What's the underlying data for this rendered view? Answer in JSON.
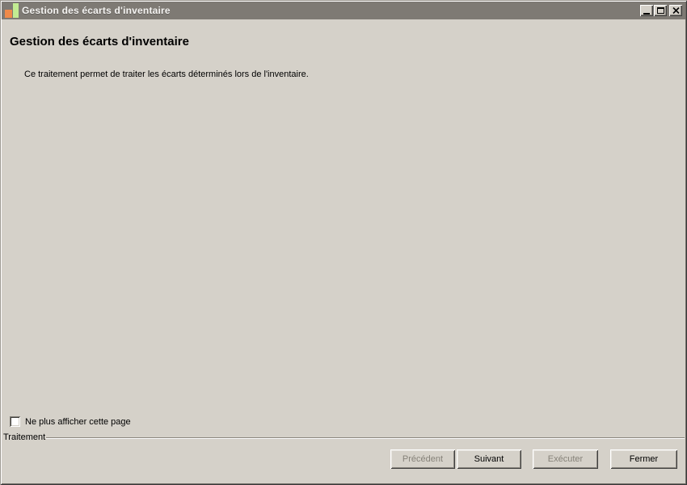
{
  "window": {
    "title": "Gestion des écarts d'inventaire"
  },
  "titlebar_controls": {
    "minimize": "minimize",
    "maximize": "maximize",
    "close": "close"
  },
  "page": {
    "heading": "Gestion des écarts d'inventaire",
    "description": "Ce traitement permet de traiter les écarts déterminés lors de l'inventaire."
  },
  "options": {
    "dont_show_label": "Ne plus afficher cette page",
    "checked": false
  },
  "group": {
    "label": "Traitement"
  },
  "buttons": {
    "previous": {
      "label": "Précédent",
      "enabled": false
    },
    "next": {
      "label": "Suivant",
      "enabled": true
    },
    "execute": {
      "label": "Exécuter",
      "enabled": false
    },
    "close": {
      "label": "Fermer",
      "enabled": true
    }
  },
  "colors": {
    "titlebar_bg": "#7e7a74",
    "titlebar_text": "#f4f3f1",
    "dialog_bg": "#d5d1c9",
    "disabled_text": "#868279",
    "icon_orange": "#ef8a4a",
    "icon_green": "#c2ec92"
  }
}
